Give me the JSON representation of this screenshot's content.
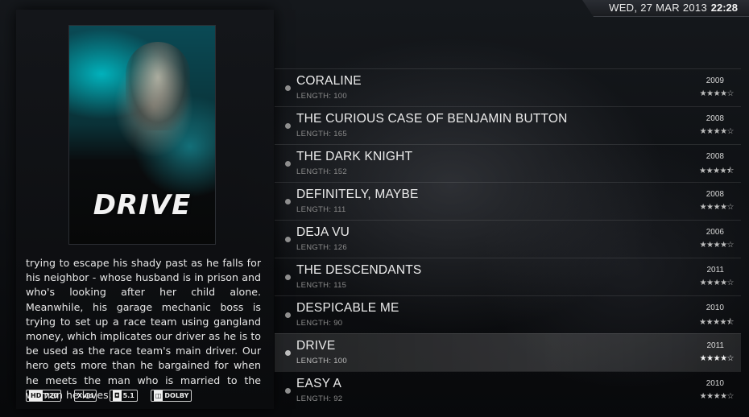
{
  "header": {
    "date": "WED, 27 MAR 2013",
    "time": "22:28"
  },
  "details": {
    "poster_title": "DRIVE",
    "plot": "trying to escape his shady past as he falls for his neighbor - whose husband is in prison and who's looking after her child alone. Meanwhile, his garage mechanic boss is trying to set up a race team using gangland money, which implicates our driver as he is to be used as the race team's main driver. Our hero gets more than he bargained for when he meets the man who is married to the woman he loves.",
    "flags": {
      "video_res_label": "HD",
      "video_res_value": "720",
      "codec": "Xvid",
      "channels": "5.1",
      "audio_brand": "DOLBY",
      "audio_sub": "DIGITAL"
    }
  },
  "movies": [
    {
      "title": "CORALINE",
      "length": "LENGTH: 100",
      "year": "2009",
      "stars": "★★★★☆",
      "rating": 4,
      "selected": false
    },
    {
      "title": "THE CURIOUS CASE OF BENJAMIN BUTTON",
      "length": "LENGTH: 165",
      "year": "2008",
      "stars": "★★★★☆",
      "rating": 4,
      "selected": false
    },
    {
      "title": "THE DARK KNIGHT",
      "length": "LENGTH: 152",
      "year": "2008",
      "stars": "★★★★⯪",
      "rating": 4.5,
      "selected": false
    },
    {
      "title": "DEFINITELY, MAYBE",
      "length": "LENGTH: 111",
      "year": "2008",
      "stars": "★★★★☆",
      "rating": 4,
      "selected": false
    },
    {
      "title": "DEJA VU",
      "length": "LENGTH: 126",
      "year": "2006",
      "stars": "★★★★☆",
      "rating": 4,
      "selected": false
    },
    {
      "title": "THE DESCENDANTS",
      "length": "LENGTH: 115",
      "year": "2011",
      "stars": "★★★★☆",
      "rating": 4,
      "selected": false
    },
    {
      "title": "DESPICABLE ME",
      "length": "LENGTH: 90",
      "year": "2010",
      "stars": "★★★★⯪",
      "rating": 4.5,
      "selected": false
    },
    {
      "title": "DRIVE",
      "length": "LENGTH: 100",
      "year": "2011",
      "stars": "★★★★☆",
      "rating": 4,
      "selected": true
    },
    {
      "title": "EASY A",
      "length": "LENGTH: 92",
      "year": "2010",
      "stars": "★★★★☆",
      "rating": 4,
      "selected": false
    }
  ]
}
